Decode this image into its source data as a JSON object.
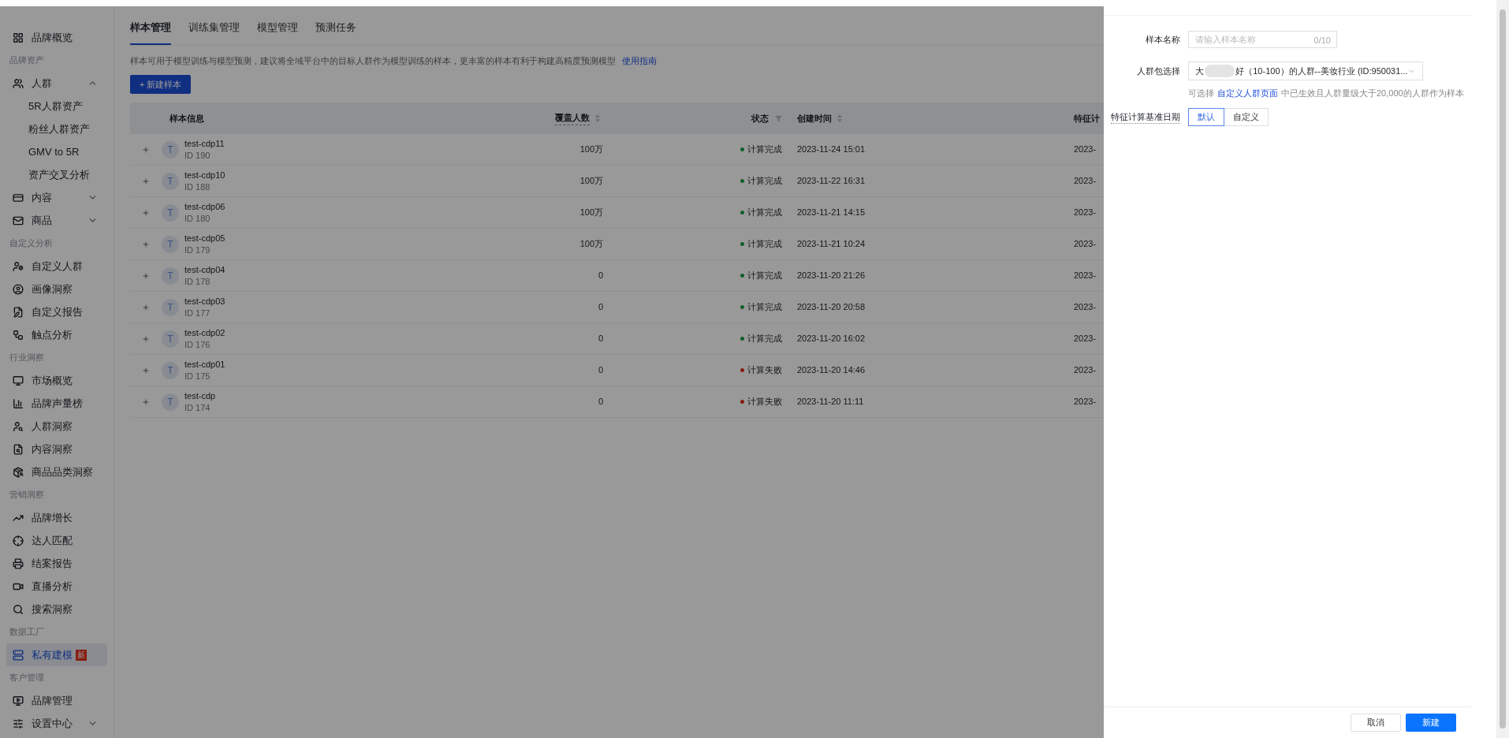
{
  "sidebar": {
    "items": [
      {
        "kind": "item",
        "label": "品牌概览",
        "selected": false
      },
      {
        "kind": "group",
        "label": "品牌资产"
      },
      {
        "kind": "item",
        "label": "人群",
        "selected": false,
        "expanded": true
      },
      {
        "kind": "subitem",
        "label": "5R人群资产",
        "selected": false
      },
      {
        "kind": "subitem",
        "label": "粉丝人群资产",
        "selected": false
      },
      {
        "kind": "subitem",
        "label": "GMV to 5R",
        "selected": false
      },
      {
        "kind": "subitem",
        "label": "资产交叉分析",
        "selected": false
      },
      {
        "kind": "item",
        "label": "内容",
        "selected": false,
        "expanded": false
      },
      {
        "kind": "item",
        "label": "商品",
        "selected": false,
        "expanded": false
      },
      {
        "kind": "group",
        "label": "自定义分析"
      },
      {
        "kind": "item",
        "label": "自定义人群",
        "selected": false
      },
      {
        "kind": "item",
        "label": "画像洞察",
        "selected": false
      },
      {
        "kind": "item",
        "label": "自定义报告",
        "selected": false
      },
      {
        "kind": "item",
        "label": "触点分析",
        "selected": false
      },
      {
        "kind": "group",
        "label": "行业洞察"
      },
      {
        "kind": "item",
        "label": "市场概览",
        "selected": false
      },
      {
        "kind": "item",
        "label": "品牌声量榜",
        "selected": false
      },
      {
        "kind": "item",
        "label": "人群洞察",
        "selected": false
      },
      {
        "kind": "item",
        "label": "内容洞察",
        "selected": false
      },
      {
        "kind": "item",
        "label": "商品品类洞察",
        "selected": false
      },
      {
        "kind": "group",
        "label": "营销洞察"
      },
      {
        "kind": "item",
        "label": "品牌增长",
        "selected": false
      },
      {
        "kind": "item",
        "label": "达人匹配",
        "selected": false
      },
      {
        "kind": "item",
        "label": "结案报告",
        "selected": false
      },
      {
        "kind": "item",
        "label": "直播分析",
        "selected": false
      },
      {
        "kind": "item",
        "label": "搜索洞察",
        "selected": false
      },
      {
        "kind": "group",
        "label": "数据工厂"
      },
      {
        "kind": "item",
        "label": "私有建模",
        "selected": true,
        "badge": "新"
      },
      {
        "kind": "group",
        "label": "客户管理"
      },
      {
        "kind": "item",
        "label": "品牌管理",
        "selected": false
      },
      {
        "kind": "item",
        "label": "设置中心",
        "selected": false,
        "expanded": false
      }
    ]
  },
  "tabs": [
    {
      "label": "样本管理",
      "selected": true
    },
    {
      "label": "训练集管理",
      "selected": false
    },
    {
      "label": "模型管理",
      "selected": false
    },
    {
      "label": "预测任务",
      "selected": false
    }
  ],
  "description": "样本可用于模型训练与模型预测，建议将全域平台中的目标人群作为模型训练的样本，更丰富的样本有利于构建高精度预测模型",
  "guide_link": "使用指南",
  "new_button": "+ 新建样本",
  "table": {
    "columns": [
      "样本信息",
      "覆盖人数",
      "状态",
      "创建时间",
      "特征计"
    ],
    "rows": [
      {
        "avatar": "T",
        "name": "test-cdp11",
        "id": "ID 190",
        "count": "100万",
        "status": "计算完成",
        "color": "#105f2c",
        "created": "2023-11-24 15:01",
        "column_5": "2023-"
      },
      {
        "avatar": "T",
        "name": "test-cdp10",
        "id": "ID 188",
        "count": "100万",
        "status": "计算完成",
        "color": "#105f2c",
        "created": "2023-11-22 16:31",
        "column_5": "2023-"
      },
      {
        "avatar": "T",
        "name": "test-cdp06",
        "id": "ID 180",
        "count": "100万",
        "status": "计算完成",
        "color": "#105f2c",
        "created": "2023-11-21 14:15",
        "column_5": "2023-"
      },
      {
        "avatar": "T",
        "name": "test-cdp05",
        "id": "ID 179",
        "count": "100万",
        "status": "计算完成",
        "color": "#105f2c",
        "created": "2023-11-21 10:24",
        "column_5": "2023-"
      },
      {
        "avatar": "T",
        "name": "test-cdp04",
        "id": "ID 178",
        "count": "0",
        "status": "计算完成",
        "color": "#105f2c",
        "created": "2023-11-20 21:26",
        "column_5": "2023-"
      },
      {
        "avatar": "T",
        "name": "test-cdp03",
        "id": "ID 177",
        "count": "0",
        "status": "计算完成",
        "color": "#105f2c",
        "created": "2023-11-20 20:58",
        "column_5": "2023-"
      },
      {
        "avatar": "T",
        "name": "test-cdp02",
        "id": "ID 176",
        "count": "0",
        "status": "计算完成",
        "color": "#105f2c",
        "created": "2023-11-20 16:02",
        "column_5": "2023-"
      },
      {
        "avatar": "T",
        "name": "test-cdp01",
        "id": "ID 175",
        "count": "0",
        "status": "计算失败",
        "color": "#861d12",
        "created": "2023-11-20 14:46",
        "column_5": "2023-"
      },
      {
        "avatar": "T",
        "name": "test-cdp",
        "id": "ID 174",
        "count": "0",
        "status": "计算失败",
        "color": "#861d12",
        "created": "2023-11-20 11:11",
        "column_5": "2023-"
      }
    ]
  },
  "drawer": {
    "name_field": {
      "label": "样本名称",
      "placeholder": "请输入样本名称",
      "counter": "0/10"
    },
    "crowd_select": {
      "label": "人群包选择",
      "value_start": "大",
      "value_end": "好（10-100）的人群--美妆行业 (ID:950031..."
    },
    "hint": {
      "before": "可选择",
      "link": "自定义人群页面",
      "after": "中已生效且人群量级大于20,000的人群作为样本"
    },
    "date_basis": {
      "label": "特征计算基准日期",
      "options": [
        {
          "label": "默认",
          "selected": true
        },
        {
          "label": "自定义",
          "selected": false
        }
      ]
    },
    "buttons": {
      "cancel": "取消",
      "submit": "新建"
    }
  }
}
